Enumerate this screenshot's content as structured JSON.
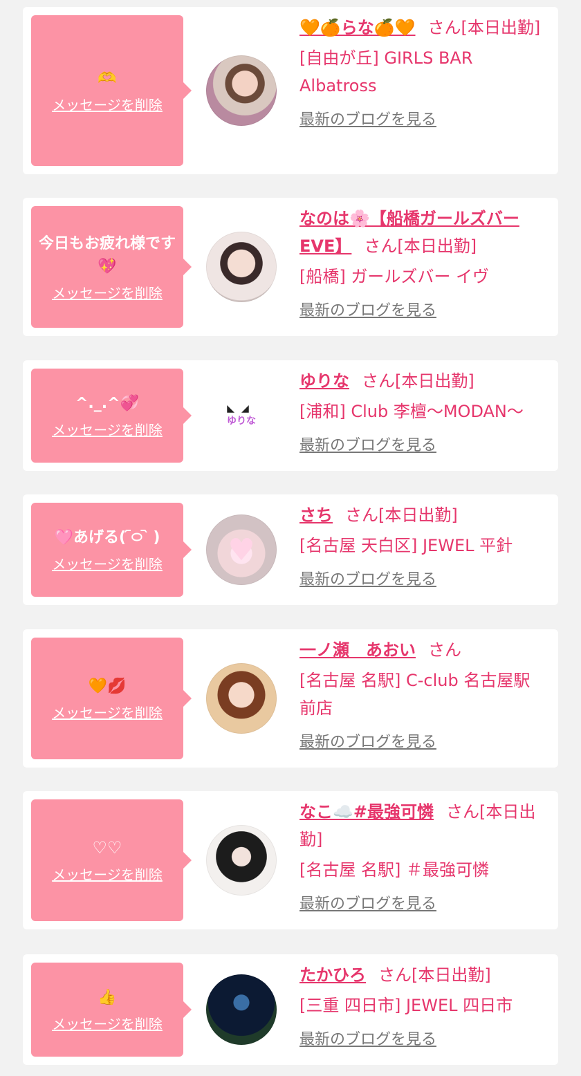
{
  "delete_label": "メッセージを削除",
  "blog_label": "最新のブログを見る",
  "accent_color": "#e6366c",
  "bubble_color": "#fc93a5",
  "cards": [
    {
      "message": "🫶",
      "name": "🧡🍊らな🍊🧡",
      "suffix": "さん[本日出勤]",
      "shop": "[自由が丘] GIRLS BAR Albatross",
      "avatar_text": ""
    },
    {
      "message": "今日もお疲れ様です💖",
      "name": "なのは🌸【船橋ガールズバーEVE】",
      "suffix": "さん[本日出勤]",
      "shop": "[船橋] ガールズバー イヴ",
      "avatar_text": ""
    },
    {
      "message": "^._.^💞",
      "name": "ゆりな",
      "suffix": "さん[本日出勤]",
      "shop": "[浦和] Club 李檀〜MODAN〜",
      "avatar_text": "ゆりな"
    },
    {
      "message": "🩷あげる( ᷇࿀ ᷆ )",
      "name": "さち",
      "suffix": "さん[本日出勤]",
      "shop": "[名古屋 天白区] JEWEL 平針",
      "avatar_text": ""
    },
    {
      "message": "🧡💋",
      "name": "一ノ瀬　あおい",
      "suffix": "さん",
      "shop": "[名古屋 名駅] C-club 名古屋駅前店",
      "avatar_text": ""
    },
    {
      "message": "♡♡",
      "name": "なこ☁️#最強可憐",
      "suffix": "さん[本日出勤]",
      "shop": "[名古屋 名駅] ＃最強可憐",
      "avatar_text": ""
    },
    {
      "message": "👍",
      "name": "たかひろ",
      "suffix": "さん[本日出勤]",
      "shop": "[三重 四日市] JEWEL 四日市",
      "avatar_text": ""
    }
  ]
}
